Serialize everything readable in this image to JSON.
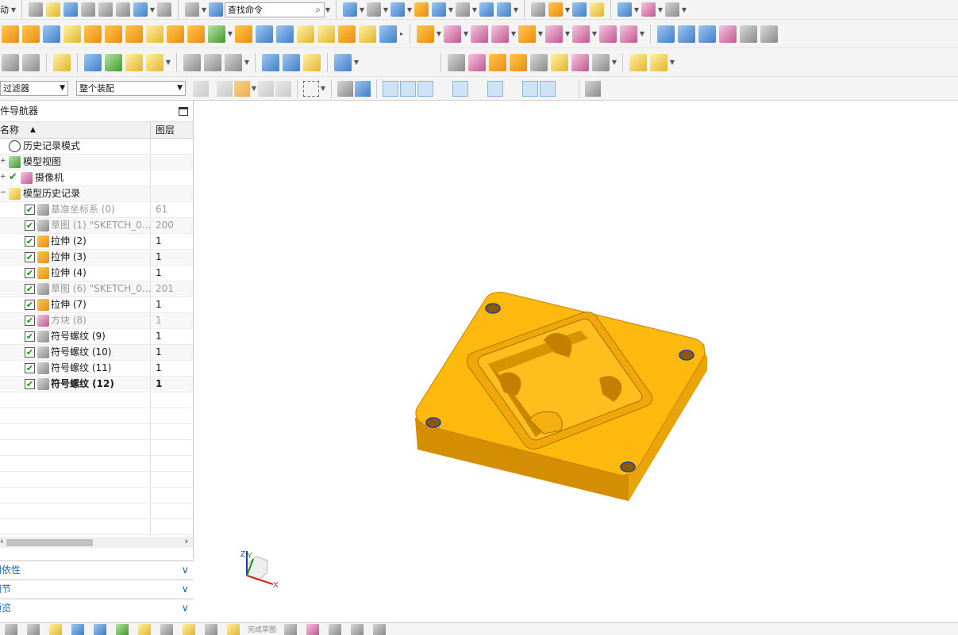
{
  "toolbar": {
    "row1_label": "动",
    "find_command_placeholder": "查找命令"
  },
  "selection_bar": {
    "filter_value": "过滤器",
    "scope_value": "整个装配"
  },
  "navigator": {
    "title": "部件导航器",
    "col_name": "名称",
    "col_layer": "图层",
    "nodes": [
      {
        "label": "历史记录模式",
        "layer": "",
        "icon": "clock-icon"
      },
      {
        "label": "模型视图",
        "layer": "",
        "icon": "model-views-icon"
      },
      {
        "label": "摄像机",
        "layer": "",
        "icon": "camera-icon"
      },
      {
        "label": "模型历史记录",
        "layer": "",
        "icon": "folder-icon"
      }
    ],
    "features": [
      {
        "label": "基准坐标系 (0)",
        "layer": "61",
        "dim": true,
        "icon": "datum-csys-icon"
      },
      {
        "label": "草图 (1) \"SKETCH_0...",
        "layer": "200",
        "dim": true,
        "icon": "sketch-icon"
      },
      {
        "label": "拉伸 (2)",
        "layer": "1",
        "dim": false,
        "icon": "extrude-icon"
      },
      {
        "label": "拉伸 (3)",
        "layer": "1",
        "dim": false,
        "icon": "extrude-icon"
      },
      {
        "label": "拉伸 (4)",
        "layer": "1",
        "dim": false,
        "icon": "extrude-icon"
      },
      {
        "label": "草图 (6) \"SKETCH_0...",
        "layer": "201",
        "dim": true,
        "icon": "sketch-icon"
      },
      {
        "label": "拉伸 (7)",
        "layer": "1",
        "dim": false,
        "icon": "extrude-icon"
      },
      {
        "label": "方块 (8)",
        "layer": "1",
        "dim": true,
        "icon": "block-icon"
      },
      {
        "label": "符号螺纹 (9)",
        "layer": "1",
        "dim": false,
        "icon": "thread-icon"
      },
      {
        "label": "符号螺纹 (10)",
        "layer": "1",
        "dim": false,
        "icon": "thread-icon"
      },
      {
        "label": "符号螺纹 (11)",
        "layer": "1",
        "dim": false,
        "icon": "thread-icon"
      },
      {
        "label": "符号螺纹 (12)",
        "layer": "1",
        "dim": false,
        "bold": true,
        "icon": "thread-icon"
      }
    ]
  },
  "panels": [
    {
      "label": "相依性"
    },
    {
      "label": "细节"
    },
    {
      "label": "预览"
    }
  ],
  "triad": {
    "x": "X",
    "y": "Y",
    "z": "Z"
  },
  "bottom_bar": {
    "text": "完成草图"
  },
  "colors": {
    "part_face": "#FDB90D",
    "part_side": "#E39C05",
    "accent_blue": "#1D6FB8",
    "check_green": "#1A8F1A"
  }
}
